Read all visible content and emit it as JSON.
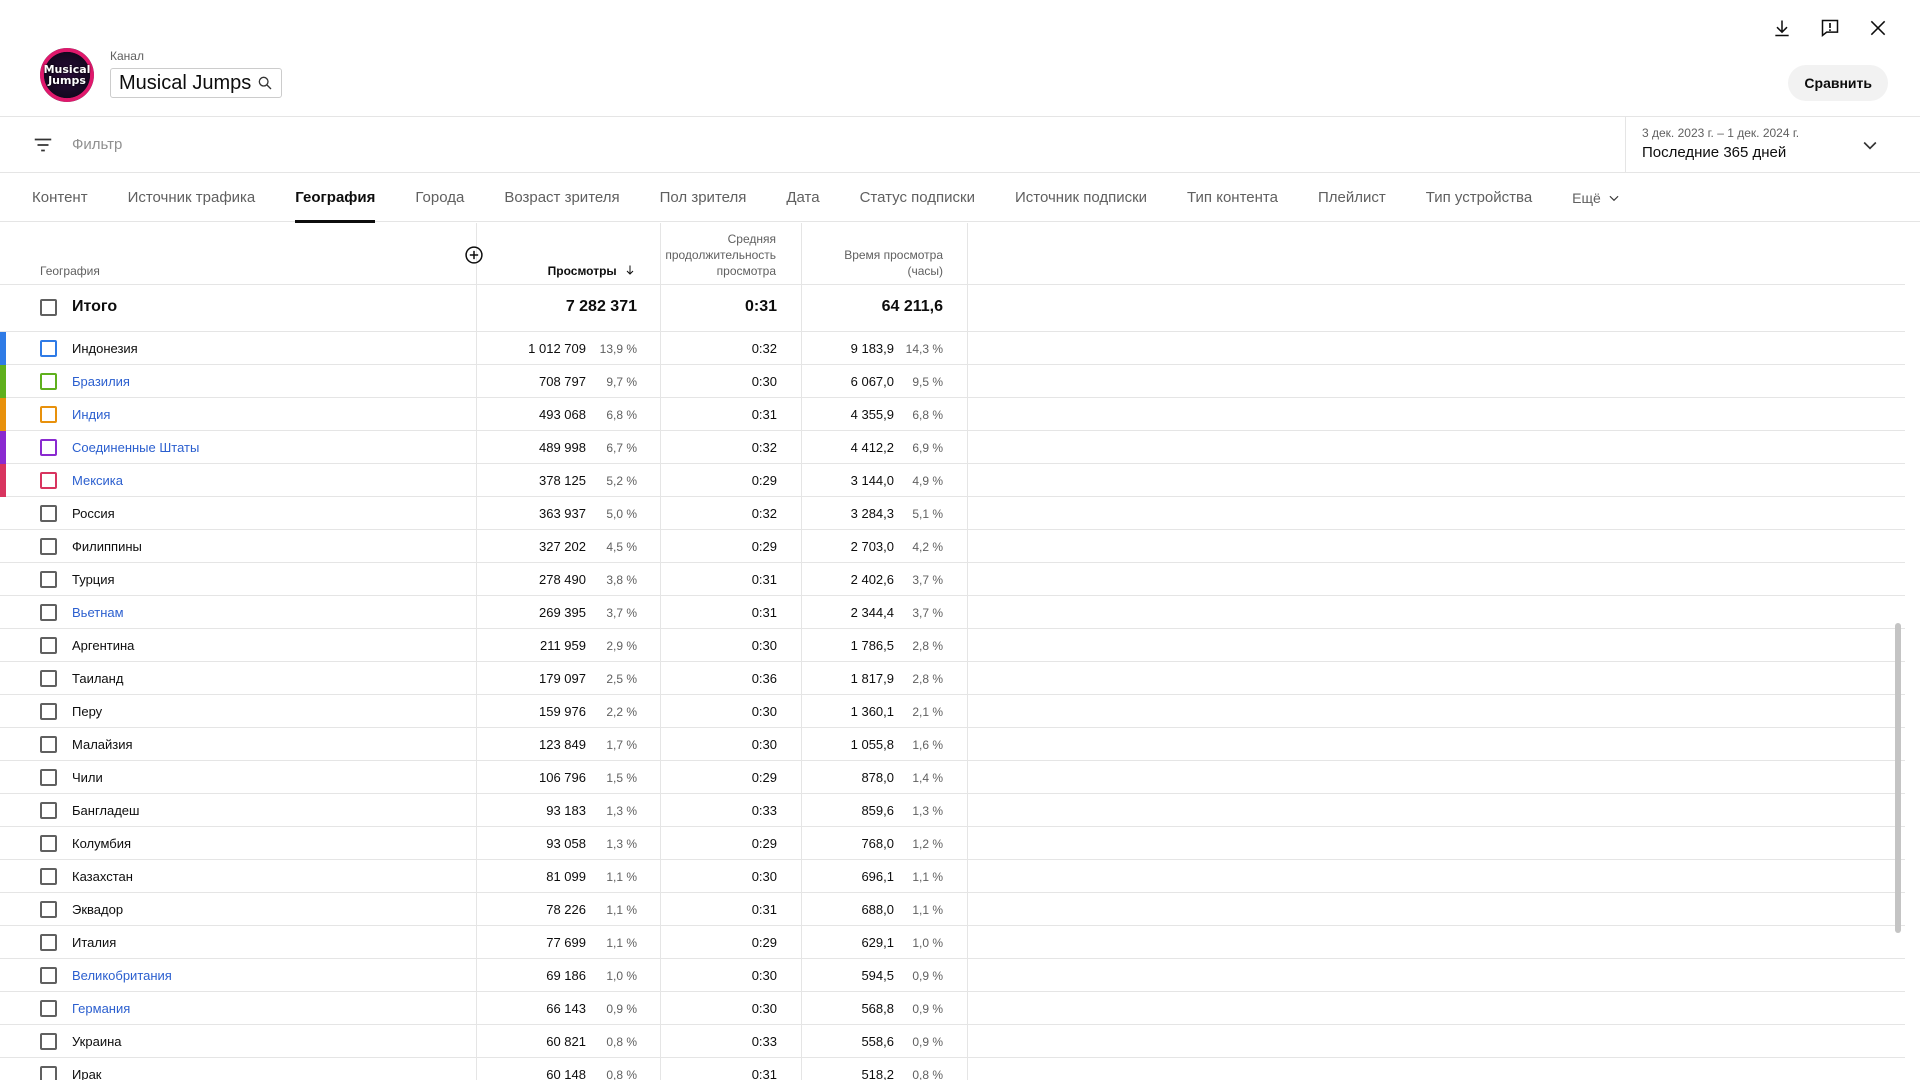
{
  "header": {
    "avatar_text": "Musical Jumps",
    "channel_caption": "Канал",
    "channel_name": "Musical Jumps",
    "compare_label": "Сравнить"
  },
  "filter": {
    "placeholder": "Фильтр",
    "date_range": "3 дек. 2023 г. – 1 дек. 2024 г.",
    "date_preset": "Последние 365 дней"
  },
  "tabs": [
    {
      "label": "Контент"
    },
    {
      "label": "Источник трафика"
    },
    {
      "label": "География",
      "active": true
    },
    {
      "label": "Города"
    },
    {
      "label": "Возраст зрителя"
    },
    {
      "label": "Пол зрителя"
    },
    {
      "label": "Дата"
    },
    {
      "label": "Статус подписки"
    },
    {
      "label": "Источник подписки"
    },
    {
      "label": "Тип контента"
    },
    {
      "label": "Плейлист"
    },
    {
      "label": "Тип устройства"
    }
  ],
  "more_tab": "Ещё",
  "table": {
    "col_geo": "География",
    "col_views": "Просмотры",
    "col_avg_line1": "Средняя",
    "col_avg_line2": "продолжительность",
    "col_avg_line3": "просмотра",
    "col_watch_line1": "Время просмотра",
    "col_watch_line2": "(часы)",
    "total": {
      "label": "Итого",
      "views": "7 282 371",
      "avg": "0:31",
      "watch": "64 211,6"
    },
    "rows": [
      {
        "country": "Индонезия",
        "views": "1 012 709",
        "views_pct": "13,9 %",
        "avg": "0:32",
        "watch": "9 183,9",
        "watch_pct": "14,3 %",
        "color": "#2f7be6",
        "link": false
      },
      {
        "country": "Бразилия",
        "views": "708 797",
        "views_pct": "9,7 %",
        "avg": "0:30",
        "watch": "6 067,0",
        "watch_pct": "9,5 %",
        "color": "#5fb01d",
        "link": true
      },
      {
        "country": "Индия",
        "views": "493 068",
        "views_pct": "6,8 %",
        "avg": "0:31",
        "watch": "4 355,9",
        "watch_pct": "6,8 %",
        "color": "#e8910c",
        "link": true
      },
      {
        "country": "Соединенные Штаты",
        "views": "489 998",
        "views_pct": "6,7 %",
        "avg": "0:32",
        "watch": "4 412,2",
        "watch_pct": "6,9 %",
        "color": "#8a2ad0",
        "link": true
      },
      {
        "country": "Мексика",
        "views": "378 125",
        "views_pct": "5,2 %",
        "avg": "0:29",
        "watch": "3 144,0",
        "watch_pct": "4,9 %",
        "color": "#d8345f",
        "link": true
      },
      {
        "country": "Россия",
        "views": "363 937",
        "views_pct": "5,0 %",
        "avg": "0:32",
        "watch": "3 284,3",
        "watch_pct": "5,1 %",
        "color": "",
        "link": false
      },
      {
        "country": "Филиппины",
        "views": "327 202",
        "views_pct": "4,5 %",
        "avg": "0:29",
        "watch": "2 703,0",
        "watch_pct": "4,2 %",
        "color": "",
        "link": false
      },
      {
        "country": "Турция",
        "views": "278 490",
        "views_pct": "3,8 %",
        "avg": "0:31",
        "watch": "2 402,6",
        "watch_pct": "3,7 %",
        "color": "",
        "link": false
      },
      {
        "country": "Вьетнам",
        "views": "269 395",
        "views_pct": "3,7 %",
        "avg": "0:31",
        "watch": "2 344,4",
        "watch_pct": "3,7 %",
        "color": "",
        "link": true
      },
      {
        "country": "Аргентина",
        "views": "211 959",
        "views_pct": "2,9 %",
        "avg": "0:30",
        "watch": "1 786,5",
        "watch_pct": "2,8 %",
        "color": "",
        "link": false
      },
      {
        "country": "Таиланд",
        "views": "179 097",
        "views_pct": "2,5 %",
        "avg": "0:36",
        "watch": "1 817,9",
        "watch_pct": "2,8 %",
        "color": "",
        "link": false
      },
      {
        "country": "Перу",
        "views": "159 976",
        "views_pct": "2,2 %",
        "avg": "0:30",
        "watch": "1 360,1",
        "watch_pct": "2,1 %",
        "color": "",
        "link": false
      },
      {
        "country": "Малайзия",
        "views": "123 849",
        "views_pct": "1,7 %",
        "avg": "0:30",
        "watch": "1 055,8",
        "watch_pct": "1,6 %",
        "color": "",
        "link": false
      },
      {
        "country": "Чили",
        "views": "106 796",
        "views_pct": "1,5 %",
        "avg": "0:29",
        "watch": "878,0",
        "watch_pct": "1,4 %",
        "color": "",
        "link": false
      },
      {
        "country": "Бангладеш",
        "views": "93 183",
        "views_pct": "1,3 %",
        "avg": "0:33",
        "watch": "859,6",
        "watch_pct": "1,3 %",
        "color": "",
        "link": false
      },
      {
        "country": "Колумбия",
        "views": "93 058",
        "views_pct": "1,3 %",
        "avg": "0:29",
        "watch": "768,0",
        "watch_pct": "1,2 %",
        "color": "",
        "link": false
      },
      {
        "country": "Казахстан",
        "views": "81 099",
        "views_pct": "1,1 %",
        "avg": "0:30",
        "watch": "696,1",
        "watch_pct": "1,1 %",
        "color": "",
        "link": false
      },
      {
        "country": "Эквадор",
        "views": "78 226",
        "views_pct": "1,1 %",
        "avg": "0:31",
        "watch": "688,0",
        "watch_pct": "1,1 %",
        "color": "",
        "link": false
      },
      {
        "country": "Италия",
        "views": "77 699",
        "views_pct": "1,1 %",
        "avg": "0:29",
        "watch": "629,1",
        "watch_pct": "1,0 %",
        "color": "",
        "link": false
      },
      {
        "country": "Великобритания",
        "views": "69 186",
        "views_pct": "1,0 %",
        "avg": "0:30",
        "watch": "594,5",
        "watch_pct": "0,9 %",
        "color": "",
        "link": true
      },
      {
        "country": "Германия",
        "views": "66 143",
        "views_pct": "0,9 %",
        "avg": "0:30",
        "watch": "568,8",
        "watch_pct": "0,9 %",
        "color": "",
        "link": true
      },
      {
        "country": "Украина",
        "views": "60 821",
        "views_pct": "0,8 %",
        "avg": "0:33",
        "watch": "558,6",
        "watch_pct": "0,9 %",
        "color": "",
        "link": false
      },
      {
        "country": "Ирак",
        "views": "60 148",
        "views_pct": "0,8 %",
        "avg": "0:31",
        "watch": "518,2",
        "watch_pct": "0,8 %",
        "color": "",
        "link": false
      }
    ]
  }
}
